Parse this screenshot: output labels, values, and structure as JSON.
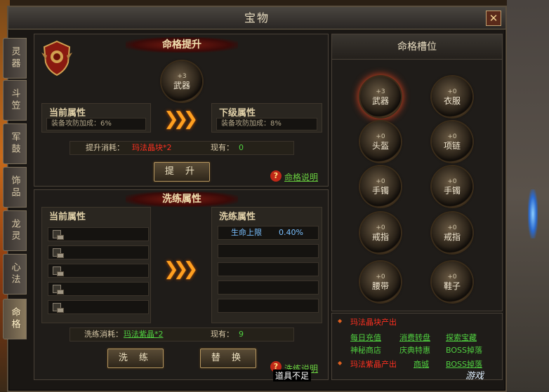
{
  "window": {
    "title": "宝物",
    "close_label": "✕"
  },
  "side_tabs": [
    {
      "label": "灵器",
      "active": false
    },
    {
      "label": "斗笠",
      "active": false
    },
    {
      "label": "军鼓",
      "active": false
    },
    {
      "label": "饰品",
      "active": false
    },
    {
      "label": "龙灵",
      "active": false
    },
    {
      "label": "心法",
      "active": false
    },
    {
      "label": "命格",
      "active": true
    }
  ],
  "upgrade": {
    "banner": "命格提升",
    "orb_level": "+3",
    "orb_name": "武器",
    "current_title": "当前属性",
    "current_value": "装备攻防加成：6%",
    "next_title": "下级属性",
    "next_value": "装备攻防加成：8%",
    "arrows": "❯❯❯",
    "cost_label": "提升消耗：",
    "cost_item": "玛法晶块*2",
    "have_label": "现有：",
    "have_value": "0",
    "button_label": "提 升",
    "help_icon": "?",
    "help_link": "命格说明"
  },
  "refine": {
    "banner": "洗练属性",
    "current_title": "当前属性",
    "new_title": "洗练属性",
    "new_attr_name": "生命上限",
    "new_attr_value": "0.40%",
    "arrows": "❯❯❯",
    "cost_label": "洗练消耗：",
    "cost_item": "玛法紫晶*2",
    "have_label": "现有：",
    "have_value": "9",
    "refine_button": "洗 练",
    "replace_button": "替 换",
    "help_link": "洗练说明",
    "tooltip": "道具不足"
  },
  "slots": {
    "header": "命格槽位",
    "items": [
      {
        "level": "+3",
        "name": "武器",
        "selected": true
      },
      {
        "level": "+0",
        "name": "衣服",
        "selected": false
      },
      {
        "level": "+0",
        "name": "头盔",
        "selected": false
      },
      {
        "level": "+0",
        "name": "项链",
        "selected": false
      },
      {
        "level": "+0",
        "name": "手镯",
        "selected": false
      },
      {
        "level": "+0",
        "name": "手镯",
        "selected": false
      },
      {
        "level": "+0",
        "name": "戒指",
        "selected": false
      },
      {
        "level": "+0",
        "name": "戒指",
        "selected": false
      },
      {
        "level": "+0",
        "name": "腰带",
        "selected": false
      },
      {
        "level": "+0",
        "name": "鞋子",
        "selected": false
      }
    ]
  },
  "sources": {
    "block_title": "玛法晶块产出",
    "block_links": [
      "每日充值",
      "消费转盘",
      "探索宝藏"
    ],
    "block_links2": [
      "神秘商店",
      "庆典特惠",
      "BOSS掉落"
    ],
    "purple_title": "玛法紫晶产出",
    "purple_link1": "商城",
    "purple_link2": "BOSS掉落"
  },
  "watermark": "游戏"
}
